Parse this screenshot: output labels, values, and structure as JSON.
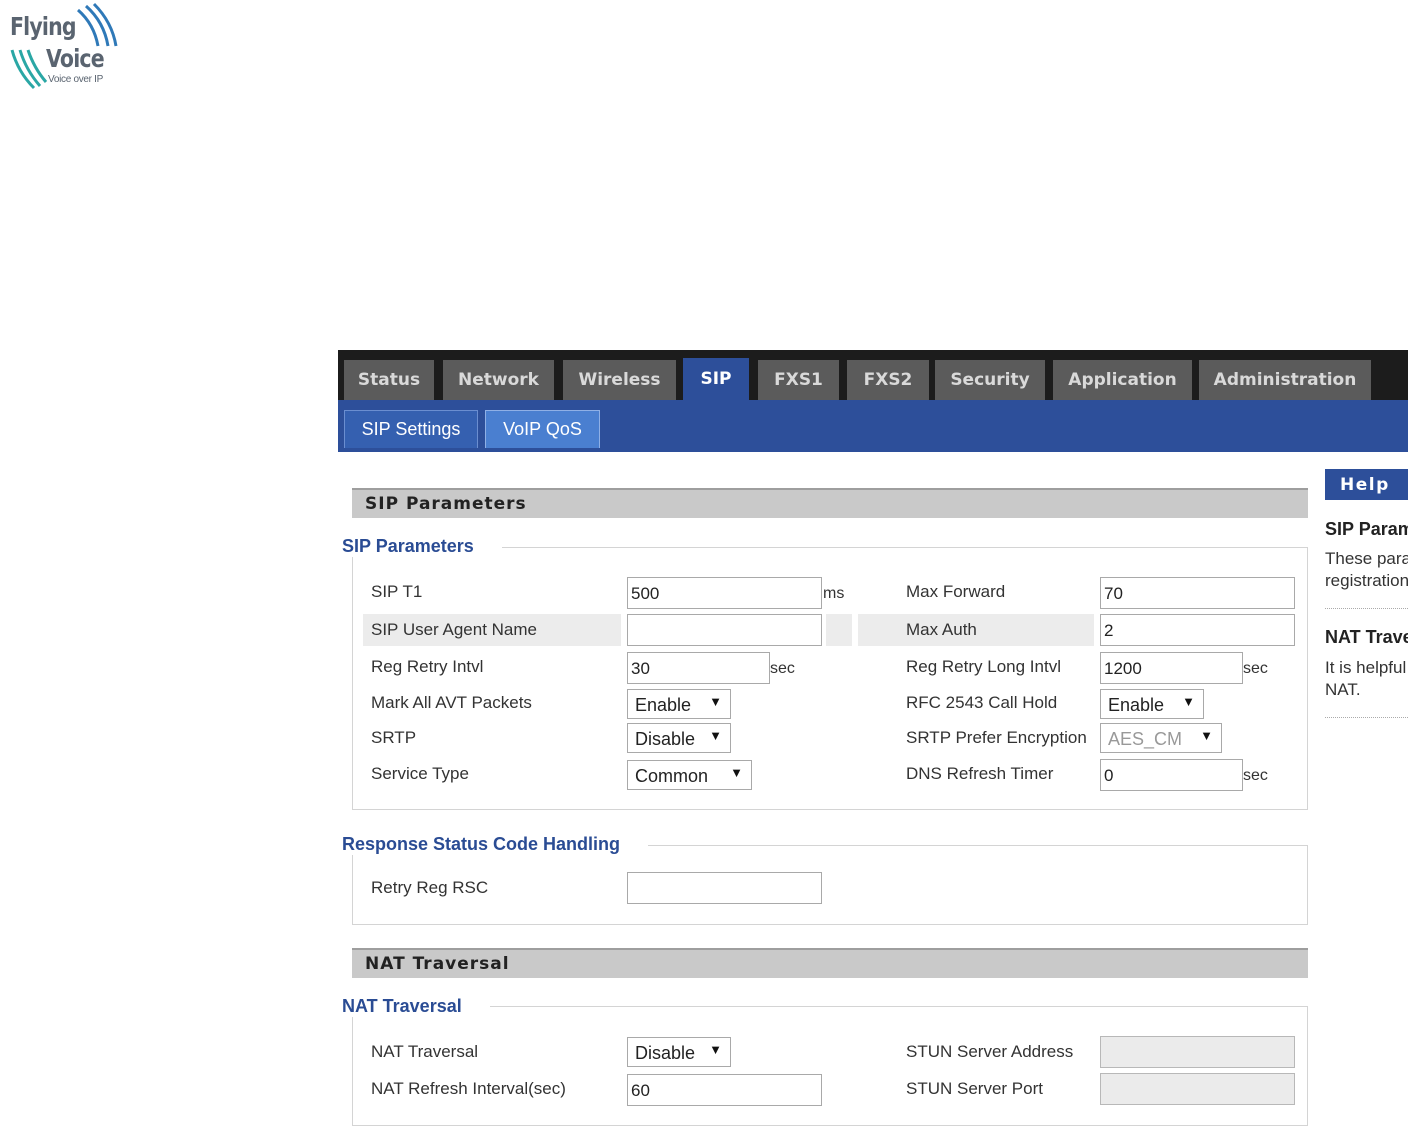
{
  "logo": {
    "line1": "Flying",
    "line2": "Voice",
    "tagline": "Voice over IP"
  },
  "nav": {
    "tabs": [
      {
        "label": "Status",
        "active": false
      },
      {
        "label": "Network",
        "active": false
      },
      {
        "label": "Wireless",
        "active": false
      },
      {
        "label": "SIP",
        "active": true
      },
      {
        "label": "FXS1",
        "active": false
      },
      {
        "label": "FXS2",
        "active": false
      },
      {
        "label": "Security",
        "active": false
      },
      {
        "label": "Application",
        "active": false
      },
      {
        "label": "Administration",
        "active": false
      }
    ],
    "subtabs": [
      {
        "label": "SIP Settings"
      },
      {
        "label": "VoIP QoS"
      }
    ]
  },
  "sip_parameters": {
    "header": "SIP Parameters",
    "legend": "SIP Parameters",
    "sip_t1": {
      "label": "SIP T1",
      "value": "500",
      "unit": "ms"
    },
    "user_agent": {
      "label": "SIP User Agent Name",
      "value": ""
    },
    "reg_retry": {
      "label": "Reg Retry Intvl",
      "value": "30",
      "unit": "sec"
    },
    "mark_avt": {
      "label": "Mark All AVT Packets",
      "value": "Enable"
    },
    "srtp": {
      "label": "SRTP",
      "value": "Disable"
    },
    "service_type": {
      "label": "Service Type",
      "value": "Common"
    },
    "max_forward": {
      "label": "Max Forward",
      "value": "70"
    },
    "max_auth": {
      "label": "Max Auth",
      "value": "2"
    },
    "reg_retry_long": {
      "label": "Reg Retry Long Intvl",
      "value": "1200",
      "unit": "sec"
    },
    "rfc2543": {
      "label": "RFC 2543 Call Hold",
      "value": "Enable"
    },
    "srtp_enc": {
      "label": "SRTP Prefer Encryption",
      "value": "AES_CM"
    },
    "dns_refresh": {
      "label": "DNS Refresh Timer",
      "value": "0",
      "unit": "sec"
    }
  },
  "response_status": {
    "legend": "Response Status Code Handling",
    "retry_reg_rsc": {
      "label": "Retry Reg RSC",
      "value": ""
    }
  },
  "nat": {
    "header": "NAT Traversal",
    "legend": "NAT Traversal",
    "traversal": {
      "label": "NAT Traversal",
      "value": "Disable"
    },
    "refresh": {
      "label": "NAT Refresh Interval(sec)",
      "value": "60"
    },
    "stun_addr": {
      "label": "STUN Server Address",
      "value": ""
    },
    "stun_port": {
      "label": "STUN Server Port",
      "value": ""
    }
  },
  "help": {
    "title": "Help",
    "s1_title": "SIP Parameters",
    "s1_line1": "These parameters are used for SIP",
    "s1_line2": "registration",
    "s2_title": "NAT Traversal",
    "s2_line1": "It is helpful",
    "s2_line2": "NAT."
  },
  "colors": {
    "nav_bg": "#1c1c1c",
    "tab_inactive": "#5b5b5b",
    "accent": "#2d4f9a",
    "legend": "#2a4c94"
  }
}
